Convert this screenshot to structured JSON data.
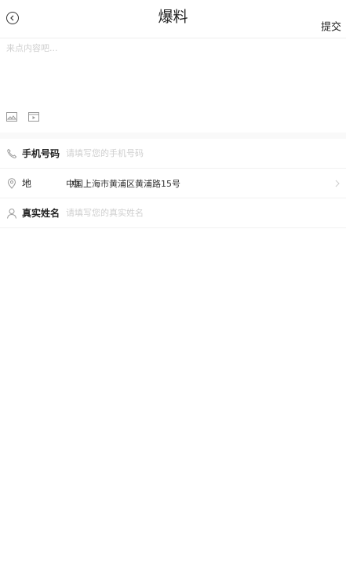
{
  "header": {
    "title": "爆料",
    "submit_label": "提交"
  },
  "content": {
    "placeholder": "来点内容吧..."
  },
  "media": {
    "icons": [
      "image-icon",
      "video-icon"
    ]
  },
  "form": {
    "phone": {
      "label": "手机号码",
      "placeholder": "请填写您的手机号码",
      "icon": "phone-icon"
    },
    "location": {
      "label": "地 点",
      "value": "中国上海市黄浦区黄浦路15号",
      "icon": "location-pin-icon"
    },
    "name": {
      "label": "真实姓名",
      "placeholder": "请填写您的真实姓名",
      "icon": "person-icon"
    }
  }
}
